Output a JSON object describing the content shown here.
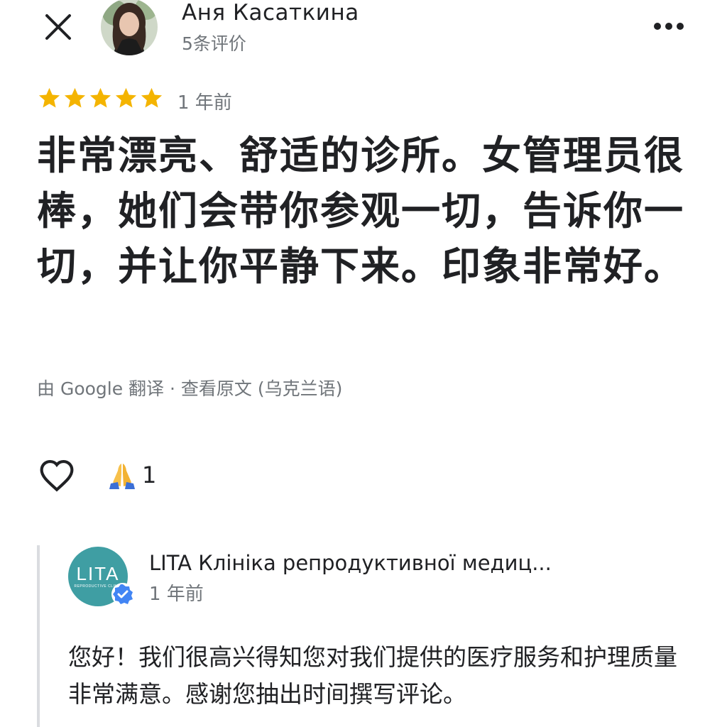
{
  "review": {
    "author": {
      "name": "Аня Касаткина",
      "review_count": "5条评价"
    },
    "rating": 5,
    "date": "1 年前",
    "text": "非常漂亮、舒适的诊所。女管理员很棒，她们会带你参观一切，告诉你一切，并让你平静下来。印象非常好。",
    "translation_note": "由 Google 翻译 · 查看原文 (乌克兰语)",
    "reactions": {
      "emoji": "🙏",
      "count": "1"
    }
  },
  "owner_reply": {
    "owner_name": "LITA Клініка репродуктивної медиц...",
    "logo_text": "LITA",
    "logo_subtext": "REPRODUCTIVE CLINIC",
    "date": "1 年前",
    "text": "您好！我们很高兴得知您对我们提供的医疗服务和护理质量非常满意。感谢您抽出时间撰写评论。"
  },
  "icons": {
    "close": "close-icon",
    "more": "more-horizontal-icon",
    "star": "star-icon",
    "like": "heart-outline-icon",
    "verified": "verified-check-icon"
  },
  "colors": {
    "star": "#f4b400",
    "secondary_text": "#70757a",
    "primary_text": "#202124",
    "owner_logo_bg": "#3f9ea3",
    "verified": "#4285f4",
    "reply_bar": "#dadce0"
  }
}
